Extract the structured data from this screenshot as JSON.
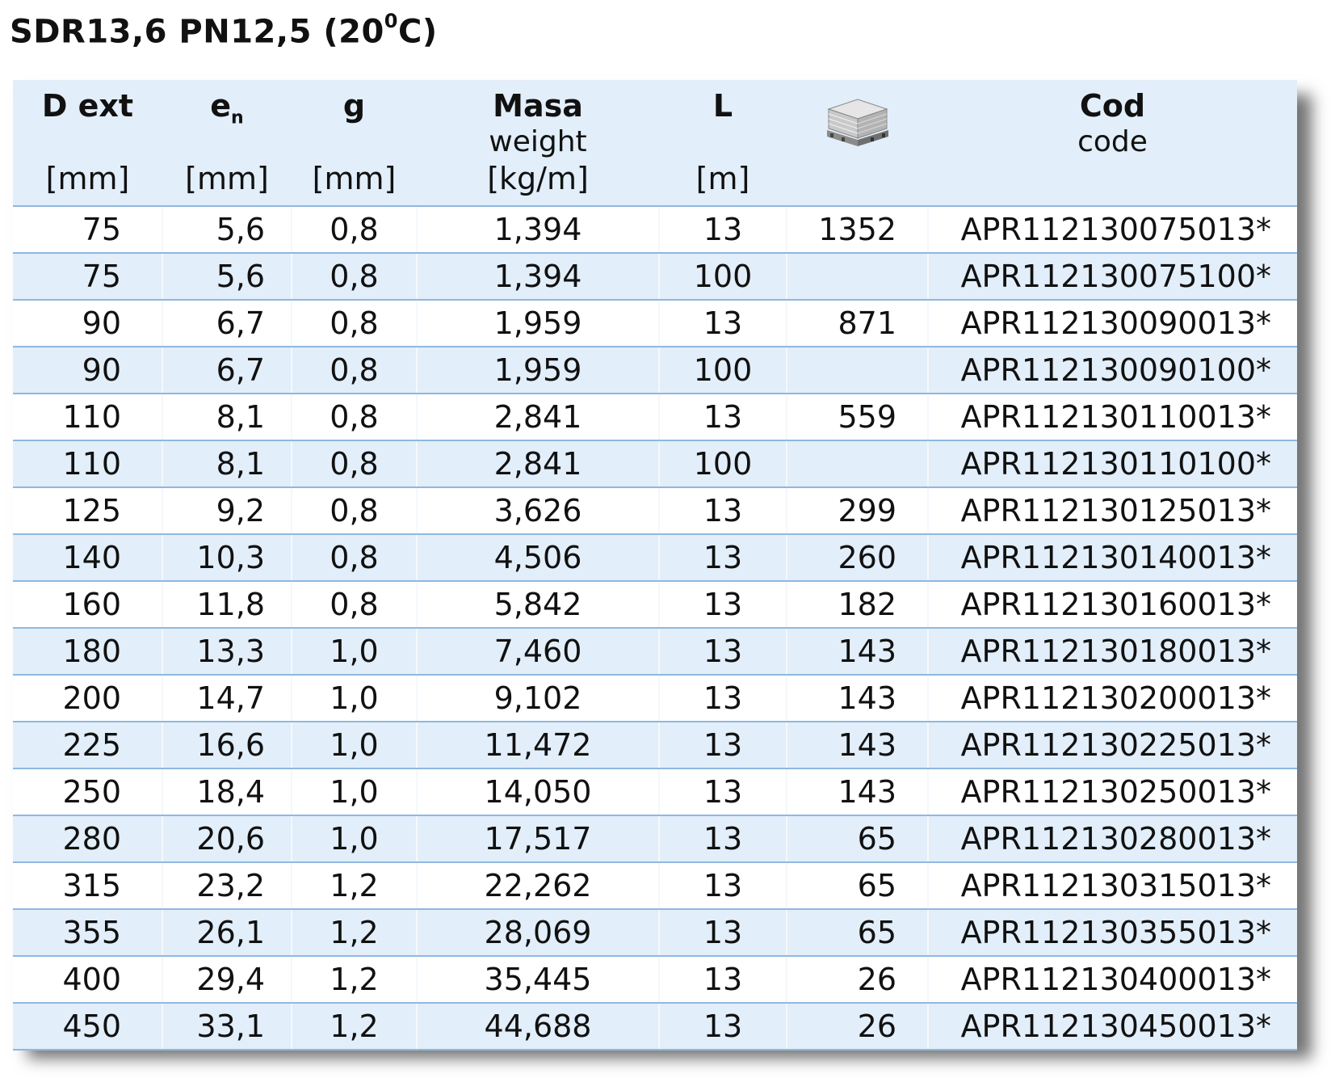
{
  "title": {
    "main": "SDR13,6 PN12,5 (20",
    "sup": "0",
    "end": "C)"
  },
  "header": {
    "d_ext": {
      "label": "D ext",
      "unit": "[mm]"
    },
    "en": {
      "label": "e",
      "sub": "n",
      "unit": "[mm]"
    },
    "g": {
      "label": "g",
      "unit": "[mm]"
    },
    "masa": {
      "label": "Masa",
      "sub": "weight",
      "unit": "[kg/m]"
    },
    "l": {
      "label": "L",
      "unit": "[m]"
    },
    "pallet": {
      "icon": "pallet-icon"
    },
    "cod": {
      "label": "Cod",
      "sub": "code"
    }
  },
  "rows": [
    {
      "d": "75",
      "en": "5,6",
      "g": "0,8",
      "masa": "1,394",
      "l": "13",
      "pallet": "1352",
      "code": "APR112130075013*"
    },
    {
      "d": "75",
      "en": "5,6",
      "g": "0,8",
      "masa": "1,394",
      "l": "100",
      "pallet": "",
      "code": "APR112130075100*"
    },
    {
      "d": "90",
      "en": "6,7",
      "g": "0,8",
      "masa": "1,959",
      "l": "13",
      "pallet": "871",
      "code": "APR112130090013*"
    },
    {
      "d": "90",
      "en": "6,7",
      "g": "0,8",
      "masa": "1,959",
      "l": "100",
      "pallet": "",
      "code": "APR112130090100*"
    },
    {
      "d": "110",
      "en": "8,1",
      "g": "0,8",
      "masa": "2,841",
      "l": "13",
      "pallet": "559",
      "code": "APR112130110013*"
    },
    {
      "d": "110",
      "en": "8,1",
      "g": "0,8",
      "masa": "2,841",
      "l": "100",
      "pallet": "",
      "code": "APR112130110100*"
    },
    {
      "d": "125",
      "en": "9,2",
      "g": "0,8",
      "masa": "3,626",
      "l": "13",
      "pallet": "299",
      "code": "APR112130125013*"
    },
    {
      "d": "140",
      "en": "10,3",
      "g": "0,8",
      "masa": "4,506",
      "l": "13",
      "pallet": "260",
      "code": "APR112130140013*"
    },
    {
      "d": "160",
      "en": "11,8",
      "g": "0,8",
      "masa": "5,842",
      "l": "13",
      "pallet": "182",
      "code": "APR112130160013*"
    },
    {
      "d": "180",
      "en": "13,3",
      "g": "1,0",
      "masa": "7,460",
      "l": "13",
      "pallet": "143",
      "code": "APR112130180013*"
    },
    {
      "d": "200",
      "en": "14,7",
      "g": "1,0",
      "masa": "9,102",
      "l": "13",
      "pallet": "143",
      "code": "APR112130200013*"
    },
    {
      "d": "225",
      "en": "16,6",
      "g": "1,0",
      "masa": "11,472",
      "l": "13",
      "pallet": "143",
      "code": "APR112130225013*"
    },
    {
      "d": "250",
      "en": "18,4",
      "g": "1,0",
      "masa": "14,050",
      "l": "13",
      "pallet": "143",
      "code": "APR112130250013*"
    },
    {
      "d": "280",
      "en": "20,6",
      "g": "1,0",
      "masa": "17,517",
      "l": "13",
      "pallet": "65",
      "code": "APR112130280013*"
    },
    {
      "d": "315",
      "en": "23,2",
      "g": "1,2",
      "masa": "22,262",
      "l": "13",
      "pallet": "65",
      "code": "APR112130315013*"
    },
    {
      "d": "355",
      "en": "26,1",
      "g": "1,2",
      "masa": "28,069",
      "l": "13",
      "pallet": "65",
      "code": "APR112130355013*"
    },
    {
      "d": "400",
      "en": "29,4",
      "g": "1,2",
      "masa": "35,445",
      "l": "13",
      "pallet": "26",
      "code": "APR112130400013*"
    },
    {
      "d": "450",
      "en": "33,1",
      "g": "1,2",
      "masa": "44,688",
      "l": "13",
      "pallet": "26",
      "code": "APR112130450013*"
    }
  ]
}
